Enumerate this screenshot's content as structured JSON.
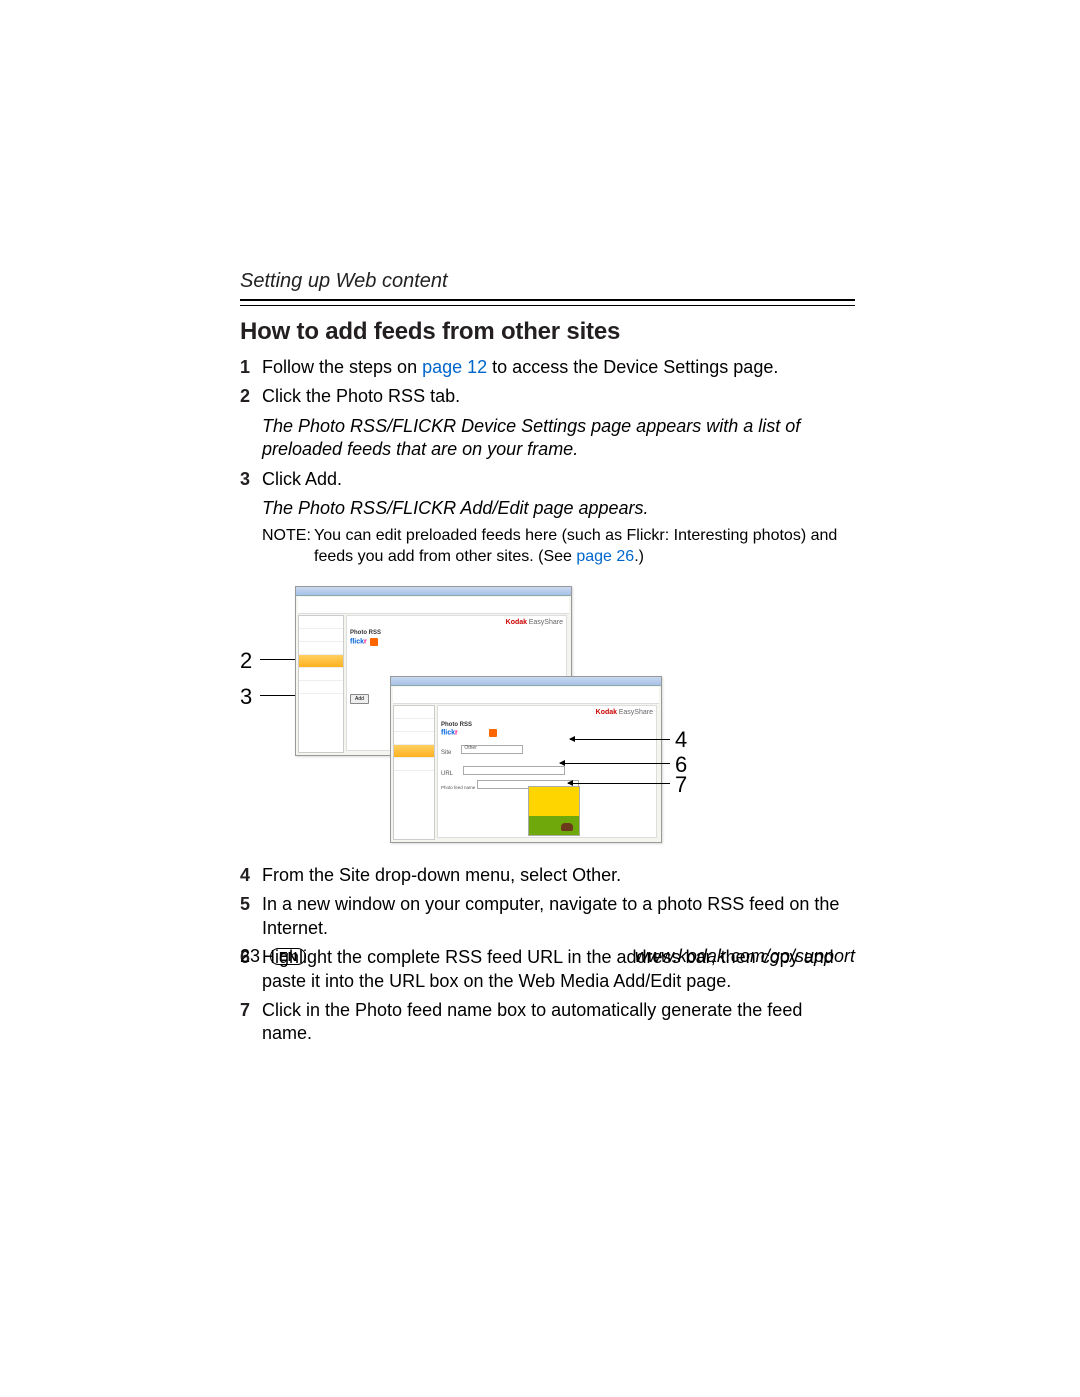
{
  "running_head": "Setting up Web content",
  "section_title": "How to add feeds from other sites",
  "steps_top": [
    {
      "n": "1",
      "pre": "Follow the steps on ",
      "link": "page 12",
      "post": " to access the Device Settings page."
    },
    {
      "n": "2",
      "text": "Click the Photo RSS tab."
    }
  ],
  "result1": "The Photo RSS/FLICKR Device Settings page appears with a list of preloaded feeds that are on your frame.",
  "step3": {
    "n": "3",
    "text": "Click Add."
  },
  "result2": "The Photo RSS/FLICKR Add/Edit page appears.",
  "note": {
    "label": "NOTE:",
    "pre": "You can edit preloaded feeds here (such as Flickr: Interesting photos) and feeds you add from other sites. (See ",
    "link": "page 26",
    "post": ".)"
  },
  "callouts_left": [
    "2",
    "3"
  ],
  "callouts_right": [
    "4",
    "6",
    "7"
  ],
  "screenshot": {
    "brand1": "Kodak",
    "brand2": "EasyShare",
    "tab_label": "Photo RSS",
    "flickr": "flickr",
    "add_btn": "Add",
    "site_label": "Site",
    "site_value": "Other",
    "url_label": "URL",
    "name_label": "Photo feed name"
  },
  "steps_bottom": [
    {
      "n": "4",
      "text": "From the Site drop-down menu, select Other."
    },
    {
      "n": "5",
      "text": "In a new window on your computer, navigate to a photo RSS feed on the Internet."
    },
    {
      "n": "6",
      "text": "Highlight the complete RSS feed URL in the address bar, then copy and paste it into the URL box on the Web Media Add/Edit page."
    },
    {
      "n": "7",
      "text": "Click in the Photo feed name box to automatically generate the feed name."
    }
  ],
  "footer": {
    "page": "23",
    "lang": "EN",
    "url": "www.kodak.com/go/support"
  }
}
